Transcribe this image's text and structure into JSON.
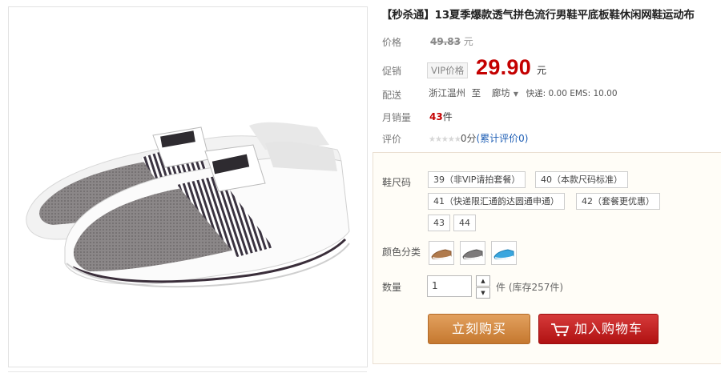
{
  "product": {
    "title": "【秒杀通】13夏季爆款透气拼色流行男鞋平底板鞋休闲网鞋运动布"
  },
  "labels": {
    "price": "价格",
    "promo": "促销",
    "ship": "配送",
    "sales": "月销量",
    "rating": "评价",
    "size": "鞋尺码",
    "color": "颜色分类",
    "qty": "数量"
  },
  "price": {
    "original": "49.83",
    "original_unit": "元",
    "vip_badge": "VIP价格",
    "promo": "29.90",
    "promo_unit": "元"
  },
  "shipping": {
    "from": "浙江温州",
    "to_word": "至",
    "to": "廊坊",
    "fees": "快递: 0.00 EMS: 10.00"
  },
  "sales": {
    "count": "43",
    "unit": "件"
  },
  "rating": {
    "stars": "★★★★★",
    "score": "0分",
    "link": "(累计评价0)"
  },
  "sizes": [
    "39（非VIP请拍套餐）",
    "40（本款尺码标准）",
    "41（快递限汇通韵达圆通申通）",
    "42（套餐更优惠）",
    "43",
    "44"
  ],
  "colors": [
    "brown-shoe-swatch",
    "grey-shoe-swatch",
    "blue-shoe-swatch"
  ],
  "quantity": {
    "value": "1",
    "up": "▲",
    "down": "▼",
    "stock": "件 (库存257件)"
  },
  "buttons": {
    "buy": "立刻购买",
    "cart": "加入购物车"
  },
  "colors_theme": {
    "price_red": "#c40000",
    "buy_orange": "#d18a44",
    "cart_red": "#c41f1f"
  }
}
